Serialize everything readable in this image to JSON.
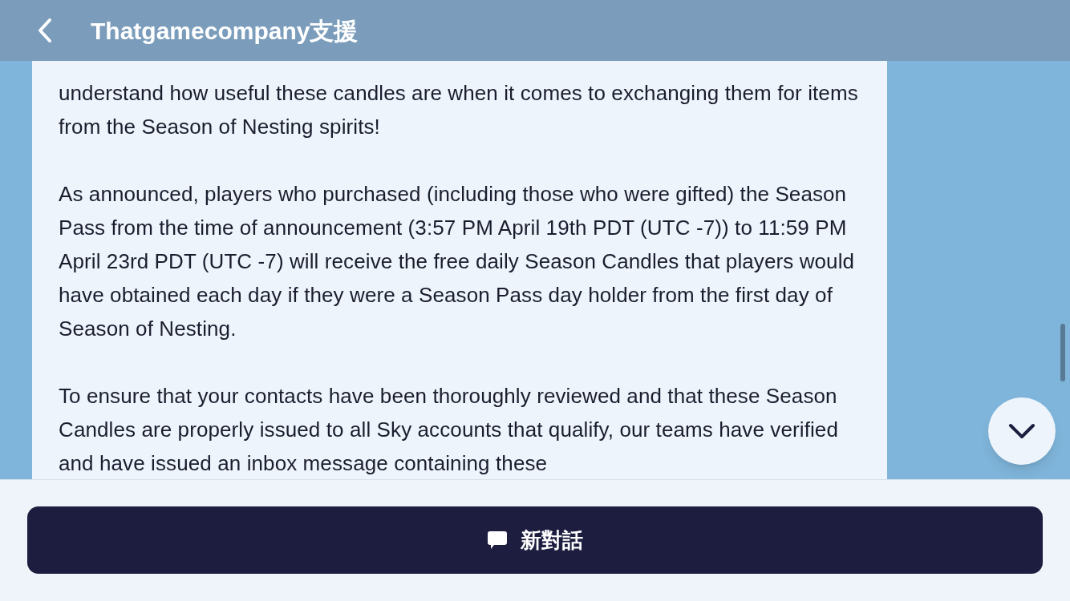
{
  "header": {
    "title": "Thatgamecompany支援"
  },
  "paragraphs": [
    "understand how useful these candles are when it comes to exchanging them for items from the Season of Nesting spirits!",
    "As announced, players who purchased (including those who were gifted) the Season Pass from the time of announcement (3:57 PM April 19th PDT (UTC -7)) to 11:59 PM April 23rd PDT (UTC -7) will receive the free daily Season Candles that players would have obtained each day if they were a Season Pass day holder from the first day of Season of Nesting.",
    "To ensure that your contacts have been thoroughly reviewed and that these Season Candles are properly issued to all Sky accounts that qualify, our teams have verified and have issued an inbox message containing these"
  ],
  "new_conversation_button": {
    "label": "新對話"
  }
}
